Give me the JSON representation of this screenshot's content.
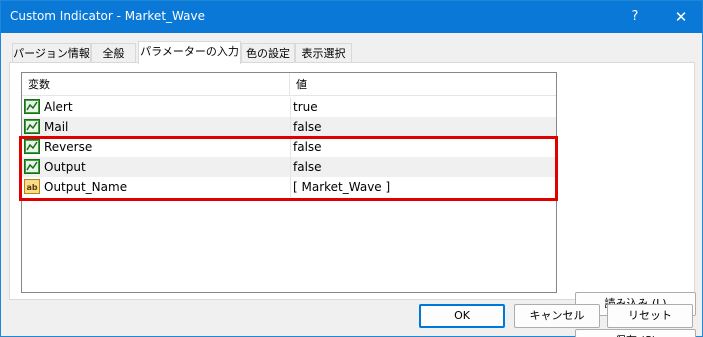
{
  "window": {
    "title": "Custom Indicator - Market_Wave",
    "help_label": "?",
    "close_label": "✕"
  },
  "tabs": [
    {
      "label": "パージョン情報",
      "active": false
    },
    {
      "label": "全般",
      "active": false
    },
    {
      "label": "パラメーターの入力",
      "active": true
    },
    {
      "label": "色の設定",
      "active": false
    },
    {
      "label": "表示選択",
      "active": false
    }
  ],
  "table": {
    "columns": [
      "変数",
      "値"
    ],
    "rows": [
      {
        "icon": "bool-icon",
        "name": "Alert",
        "value": "true"
      },
      {
        "icon": "bool-icon",
        "name": "Mail",
        "value": "false"
      },
      {
        "icon": "bool-icon",
        "name": "Reverse",
        "value": "false"
      },
      {
        "icon": "bool-icon",
        "name": "Output",
        "value": "false"
      },
      {
        "icon": "string-icon",
        "name": "Output_Name",
        "value": "[ Market_Wave ]"
      }
    ]
  },
  "buttons": {
    "load": "読み込み (L)",
    "save": "保存 (S)",
    "ok": "OK",
    "cancel": "キャンセル",
    "reset": "リセット"
  },
  "icon_glyphs": {
    "bool_icon_text": "",
    "string_icon_text": "ab"
  },
  "colors": {
    "titlebar": "#0a78d7",
    "highlight": "#e00000",
    "bool_icon": "#3aa13a",
    "string_icon": "#e6b84a"
  }
}
